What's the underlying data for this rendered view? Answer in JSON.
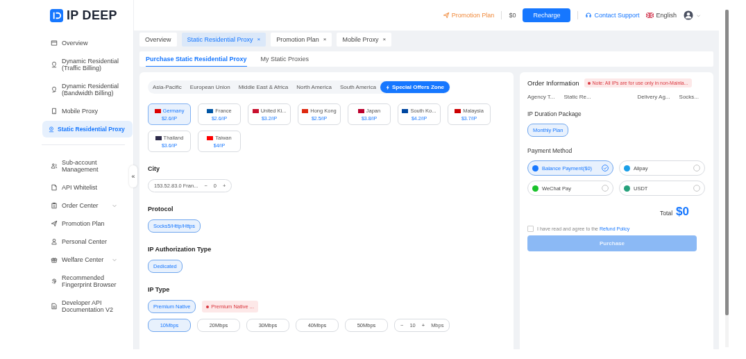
{
  "logo": {
    "text": "IP DEEP"
  },
  "header": {
    "promotion": "Promotion Plan",
    "balance": "$0",
    "recharge": "Recharge",
    "support": "Contact Support",
    "language": "English"
  },
  "sidebar": {
    "items": [
      {
        "label": "Overview",
        "selected": false
      },
      {
        "label": "Dynamic Residential (Traffic Billing)",
        "selected": false
      },
      {
        "label": "Dynamic Residential (Bandwidth Billing)",
        "selected": false
      },
      {
        "label": "Mobile Proxy",
        "selected": false
      },
      {
        "label": "Static Residential Proxy",
        "selected": true
      },
      {
        "label": "Sub-account Management",
        "selected": false
      },
      {
        "label": "API Whitelist",
        "selected": false
      },
      {
        "label": "Order Center",
        "selected": false,
        "expanded": false
      },
      {
        "label": "Promotion Plan",
        "selected": false
      },
      {
        "label": "Personal Center",
        "selected": false
      },
      {
        "label": "Welfare Center",
        "selected": false,
        "expanded": false
      },
      {
        "label": "Recommended Fingerprint Browser",
        "selected": false
      },
      {
        "label": "Developer API Documentation V2",
        "selected": false
      }
    ],
    "collapse": "«"
  },
  "tabs": [
    {
      "label": "Overview",
      "selected": false
    },
    {
      "label": "Static Residential Proxy",
      "selected": true,
      "close": "×"
    },
    {
      "label": "Promotion Plan",
      "selected": false,
      "close": "×"
    },
    {
      "label": "Mobile Proxy",
      "selected": false,
      "close": "×"
    }
  ],
  "subtabs": [
    {
      "label": "Purchase Static Residential Proxy",
      "selected": true
    },
    {
      "label": "My Static Proxies",
      "selected": false
    }
  ],
  "regions": [
    {
      "label": "Asia-Pacific",
      "selected": false
    },
    {
      "label": "European Union",
      "selected": false
    },
    {
      "label": "Middle East & Africa",
      "selected": false
    },
    {
      "label": "North America",
      "selected": false
    },
    {
      "label": "South America",
      "selected": false
    },
    {
      "label": "Special Offers Zone",
      "selected": true
    }
  ],
  "countries": [
    {
      "name": "Germany",
      "price": "$2.6/IP",
      "selected": true,
      "color": "#dd0000"
    },
    {
      "name": "France",
      "price": "$2.6/IP",
      "selected": false,
      "color": "#0055a4"
    },
    {
      "name": "United Ki...",
      "price": "$3.2/IP",
      "selected": false,
      "color": "#c8102e"
    },
    {
      "name": "Hong Kong",
      "price": "$2.5/IP",
      "selected": false,
      "color": "#de2910"
    },
    {
      "name": "Japan",
      "price": "$3.8/IP",
      "selected": false,
      "color": "#bc002d"
    },
    {
      "name": "South Ko...",
      "price": "$4.2/IP",
      "selected": false,
      "color": "#0047a0"
    },
    {
      "name": "Malaysia",
      "price": "$3.7/IP",
      "selected": false,
      "color": "#cc0001"
    },
    {
      "name": "Thailand",
      "price": "$3.6/IP",
      "selected": false,
      "color": "#2d2a4a"
    },
    {
      "name": "Taiwan",
      "price": "$4/IP",
      "selected": false,
      "color": "#fe0000"
    }
  ],
  "city": {
    "label": "City",
    "value": "153.52.83.0 Fran...",
    "minus": "−",
    "count": "0",
    "plus": "+"
  },
  "protocol": {
    "label": "Protocol",
    "options": [
      {
        "label": "Socks5/Http/Https",
        "selected": true
      }
    ]
  },
  "authorization": {
    "label": "IP Authorization Type",
    "options": [
      {
        "label": "Dedicated",
        "selected": true
      }
    ]
  },
  "ip_type": {
    "label": "IP Type",
    "options": [
      {
        "label": "Premium Native",
        "selected": true
      }
    ],
    "tag": "Premium Native ..."
  },
  "bandwidth": {
    "options": [
      {
        "label": "10Mbps",
        "selected": true
      },
      {
        "label": "20Mbps",
        "selected": false
      },
      {
        "label": "30Mbps",
        "selected": false
      },
      {
        "label": "40Mbps",
        "selected": false
      },
      {
        "label": "50Mbps",
        "selected": false
      }
    ],
    "custom": {
      "minus": "−",
      "value": "10",
      "plus": "+",
      "unit": "Mbps"
    }
  },
  "order": {
    "title": "Order Information",
    "note": "Note: All IPs are for use only in non-Mainla...",
    "summary_left": [
      "Agency T...",
      "Static Re..."
    ],
    "summary_right": [
      "Delivery Ag...",
      "Socks..."
    ],
    "duration_label": "IP Duration Package",
    "durations": [
      {
        "label": "Monthly Plan",
        "selected": true
      }
    ],
    "payment_label": "Payment Method",
    "payments": [
      {
        "label": "Balance Payment($0)",
        "selected": true,
        "color": "#1677ff"
      },
      {
        "label": "Alipay",
        "selected": false,
        "color": "#1a9fe8"
      },
      {
        "label": "WeChat Pay",
        "selected": false,
        "color": "#19c22b"
      },
      {
        "label": "USDT",
        "selected": false,
        "color": "#26a17b"
      }
    ],
    "total_label": "Total",
    "total": "$0",
    "agree": {
      "checked": false,
      "text": "I have read and agree to the",
      "link": "Refund Policy"
    },
    "purchase": {
      "label": "Purchase",
      "disabled": true
    }
  }
}
